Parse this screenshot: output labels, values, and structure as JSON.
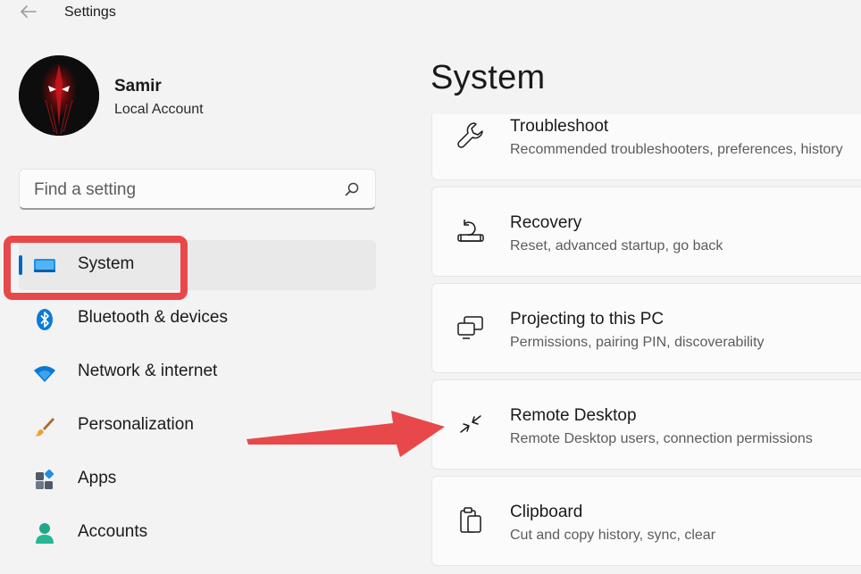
{
  "window": {
    "title": "Settings"
  },
  "user": {
    "name": "Samir",
    "account_type": "Local Account"
  },
  "search": {
    "placeholder": "Find a setting"
  },
  "nav": {
    "items": [
      {
        "label": "System",
        "icon": "system-icon",
        "selected": true
      },
      {
        "label": "Bluetooth & devices",
        "icon": "bluetooth-icon"
      },
      {
        "label": "Network & internet",
        "icon": "wifi-icon"
      },
      {
        "label": "Personalization",
        "icon": "brush-icon"
      },
      {
        "label": "Apps",
        "icon": "apps-icon"
      },
      {
        "label": "Accounts",
        "icon": "person-icon"
      }
    ]
  },
  "main": {
    "title": "System",
    "cards": [
      {
        "title": "Troubleshoot",
        "description": "Recommended troubleshooters, preferences, history",
        "icon": "wrench-icon"
      },
      {
        "title": "Recovery",
        "description": "Reset, advanced startup, go back",
        "icon": "recovery-icon"
      },
      {
        "title": "Projecting to this PC",
        "description": "Permissions, pairing PIN, discoverability",
        "icon": "projecting-icon"
      },
      {
        "title": "Remote Desktop",
        "description": "Remote Desktop users, connection permissions",
        "icon": "remote-desktop-icon"
      },
      {
        "title": "Clipboard",
        "description": "Cut and copy history, sync, clear",
        "icon": "clipboard-icon"
      }
    ]
  },
  "colors": {
    "accent": "#0067c0",
    "annotation": "#e8484a",
    "background": "#f3f3f3",
    "card": "#fbfbfb"
  }
}
